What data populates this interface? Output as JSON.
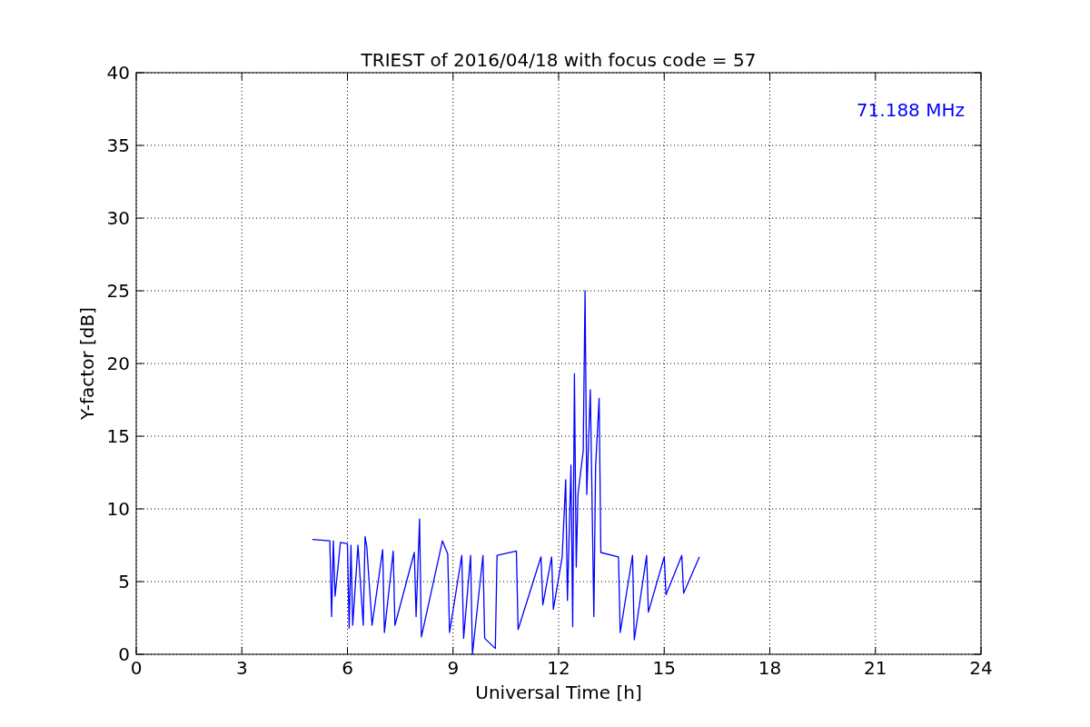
{
  "figure": {
    "chart_data": {
      "type": "line",
      "title": "TRIEST of 2016/04/18 with focus code = 57",
      "xlabel": "Universal Time [h]",
      "ylabel": "Y-factor [dB]",
      "xlim": [
        0,
        24
      ],
      "ylim": [
        0,
        40
      ],
      "xticks": [
        0,
        3,
        6,
        9,
        12,
        15,
        18,
        21,
        24
      ],
      "yticks": [
        0,
        5,
        10,
        15,
        20,
        25,
        30,
        35,
        40
      ],
      "x": [
        5,
        5.5,
        5.55,
        5.6,
        5.65,
        5.8,
        6.0,
        6.05,
        6.1,
        6.15,
        6.3,
        6.45,
        6.5,
        6.55,
        6.7,
        7.0,
        7.05,
        7.3,
        7.35,
        7.9,
        7.95,
        8.05,
        8.1,
        8.7,
        8.85,
        8.9,
        9.25,
        9.3,
        9.5,
        9.55,
        9.85,
        9.9,
        10.2,
        10.25,
        10.8,
        10.85,
        11.5,
        11.55,
        11.8,
        11.85,
        12.1,
        12.2,
        12.25,
        12.35,
        12.4,
        12.45,
        12.5,
        12.55,
        12.7,
        12.72,
        12.75,
        12.8,
        12.9,
        13.0,
        13.05,
        13.15,
        13.2,
        13.7,
        13.75,
        14.1,
        14.15,
        14.5,
        14.55,
        15.0,
        15.05,
        15.5,
        15.55,
        16
      ],
      "series": [
        {
          "color": "#0000ff",
          "values": [
            7.9,
            7.8,
            2.6,
            7.8,
            4,
            7.7,
            7.6,
            1.8,
            7.5,
            2,
            7.5,
            2,
            8.1,
            7.4,
            2,
            7.2,
            1.5,
            7.1,
            2,
            7.0,
            2.6,
            9.3,
            1.2,
            7.8,
            6.9,
            1.5,
            6.8,
            1.1,
            6.8,
            0,
            6.8,
            1.1,
            0.4,
            6.8,
            7.1,
            1.7,
            6.7,
            3.4,
            6.7,
            3.1,
            6.7,
            12,
            3.7,
            13,
            1.9,
            19.3,
            6,
            11,
            14,
            18.5,
            25,
            11,
            18.2,
            2.6,
            12.9,
            17.6,
            7,
            6.7,
            1.5,
            6.8,
            1.0,
            6.8,
            2.9,
            6.7,
            4.1,
            6.8,
            4.2,
            6.7
          ]
        }
      ],
      "grid": true,
      "annotations": [
        "71.188 MHz"
      ]
    }
  }
}
